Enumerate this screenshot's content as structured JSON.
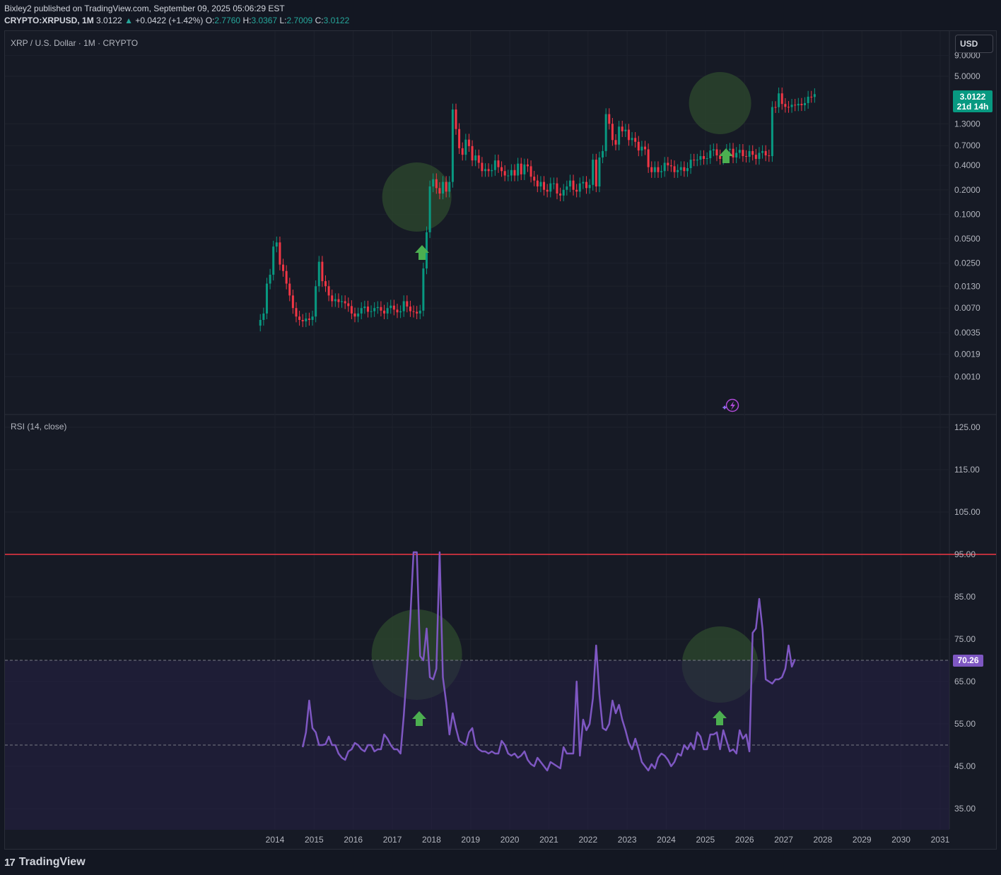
{
  "header": {
    "publish_line": "Bixley2 published on TradingView.com, September 09, 2025 05:06:29 EST",
    "symbol": "CRYPTO:XRPUSD, 1M",
    "last": "3.0122",
    "change_arrow": "▲",
    "change": "+0.0422 (+1.42%)",
    "o_label": "O:",
    "o_value": "2.7760",
    "h_label": "H:",
    "h_value": "3.0367",
    "l_label": "L:",
    "l_value": "2.7009",
    "c_label": "C:",
    "c_value": "3.0122"
  },
  "currency_button": "USD",
  "price_pane": {
    "title": "XRP / U.S. Dollar · 1M · CRYPTO"
  },
  "rsi_pane": {
    "title": "RSI (14, close)"
  },
  "last_price_tag": {
    "price": "3.0122",
    "countdown": "21d 14h"
  },
  "rsi_value_tag": "70.26",
  "footer": {
    "logo_mark": "17",
    "logo_text": "TradingView"
  },
  "colors": {
    "background": "#161a25",
    "up": "#089981",
    "down": "#f23645",
    "rsi": "#7e57c2",
    "rsi_band": "#262045",
    "overbought_line": "#f23645",
    "highlight": "#2e4a2e",
    "arrow": "#4caf50"
  },
  "icons": {
    "arrow": "up-arrow-icon",
    "bolt": "lightning-icon"
  },
  "chart_data": [
    {
      "type": "candlestick",
      "title": "XRP / U.S. Dollar · 1M · CRYPTO",
      "y_scale": "log",
      "y_ticks": [
        "9.0000",
        "5.0000",
        "1.3000",
        "0.7000",
        "0.4000",
        "0.2000",
        "0.1000",
        "0.0500",
        "0.0250",
        "0.0130",
        "0.0070",
        "0.0035",
        "0.0019",
        "0.0010"
      ],
      "x_ticks": [
        "2014",
        "2015",
        "2016",
        "2017",
        "2018",
        "2019",
        "2020",
        "2021",
        "2022",
        "2023",
        "2024",
        "2025",
        "2026",
        "2027",
        "2028",
        "2029",
        "2030",
        "2031"
      ],
      "grid": true,
      "start_month": "2013-08",
      "closes": [
        0.005,
        0.006,
        0.014,
        0.018,
        0.04,
        0.045,
        0.024,
        0.02,
        0.014,
        0.01,
        0.007,
        0.0055,
        0.005,
        0.0048,
        0.0052,
        0.005,
        0.0055,
        0.013,
        0.026,
        0.015,
        0.013,
        0.01,
        0.0085,
        0.009,
        0.0083,
        0.0085,
        0.008,
        0.0074,
        0.006,
        0.0055,
        0.006,
        0.007,
        0.0073,
        0.0063,
        0.0064,
        0.007,
        0.0072,
        0.0065,
        0.006,
        0.007,
        0.0075,
        0.0067,
        0.0062,
        0.0064,
        0.0085,
        0.0073,
        0.0064,
        0.0063,
        0.006,
        0.0065,
        0.0215,
        0.06,
        0.22,
        0.27,
        0.21,
        0.18,
        0.25,
        0.19,
        0.25,
        1.95,
        1.12,
        0.65,
        0.54,
        0.83,
        0.69,
        0.46,
        0.53,
        0.43,
        0.34,
        0.36,
        0.34,
        0.35,
        0.46,
        0.38,
        0.34,
        0.3,
        0.3,
        0.35,
        0.3,
        0.42,
        0.31,
        0.41,
        0.39,
        0.29,
        0.26,
        0.22,
        0.25,
        0.2,
        0.19,
        0.24,
        0.24,
        0.18,
        0.17,
        0.2,
        0.22,
        0.26,
        0.2,
        0.19,
        0.24,
        0.25,
        0.21,
        0.23,
        0.47,
        0.22,
        0.5,
        0.6,
        1.71,
        1.3,
        0.82,
        0.72,
        1.2,
        1.05,
        1.1,
        0.82,
        0.87,
        0.78,
        0.61,
        0.68,
        0.63,
        0.38,
        0.33,
        0.38,
        0.33,
        0.34,
        0.43,
        0.4,
        0.39,
        0.33,
        0.35,
        0.38,
        0.34,
        0.37,
        0.47,
        0.46,
        0.47,
        0.52,
        0.48,
        0.49,
        0.61,
        0.63,
        0.53,
        0.48,
        0.5,
        0.62,
        0.64,
        0.5,
        0.57,
        0.62,
        0.52,
        0.51,
        0.6,
        0.54,
        0.48,
        0.57,
        0.6,
        0.53,
        0.52,
        2.09,
        2.08,
        3.08,
        2.28,
        2.1,
        2.09,
        2.23,
        2.19,
        2.29,
        2.2,
        2.34,
        2.8,
        2.78,
        3.0122
      ]
    },
    {
      "type": "line",
      "title": "RSI (14, close)",
      "y_ticks": [
        "125.00",
        "115.00",
        "105.00",
        "95.00",
        "85.00",
        "75.00",
        "65.00",
        "55.00",
        "45.00",
        "35.00"
      ],
      "reference_lines": [
        95,
        70,
        50
      ],
      "band": [
        50,
        70
      ],
      "start_month": "2014-09",
      "values": [
        49.5,
        53,
        60.5,
        54,
        53,
        50,
        50,
        50.2,
        52,
        50,
        50,
        48,
        47,
        46.5,
        48.5,
        49,
        50.5,
        50,
        49,
        48.5,
        50,
        50,
        48.5,
        49,
        49,
        52.5,
        51.5,
        50,
        49,
        49,
        48,
        57,
        68,
        80,
        95.5,
        95.5,
        71,
        70,
        77.5,
        66,
        65.5,
        68,
        95.5,
        66,
        60,
        52.5,
        57.5,
        54,
        51,
        50.5,
        50,
        53,
        54,
        50,
        49,
        48.5,
        48.5,
        48,
        48.5,
        48,
        48,
        51,
        50,
        48,
        47.5,
        48,
        47,
        47.5,
        48.5,
        46.5,
        45.5,
        45,
        47,
        46,
        45,
        44,
        46,
        45.5,
        45,
        44.5,
        49.5,
        48,
        48,
        48,
        65,
        47.5,
        56,
        53.5,
        55,
        61,
        73.5,
        62,
        54,
        53.5,
        55,
        60.5,
        57.5,
        59.5,
        56,
        53.5,
        50.5,
        49,
        51.5,
        49,
        46,
        45,
        44,
        45.5,
        44.5,
        47,
        48,
        47.5,
        46.5,
        45,
        46,
        48,
        47.5,
        50,
        49,
        50.5,
        49,
        53,
        52,
        49,
        49,
        52.5,
        52.5,
        53,
        49,
        53.5,
        51,
        48.5,
        49,
        48,
        53.5,
        51.5,
        52.5,
        48.5,
        76.5,
        77.5,
        84.5,
        77.5,
        65.5,
        65,
        64.5,
        65.5,
        65.5,
        66,
        68,
        73.5,
        68.5,
        70.26
      ]
    }
  ]
}
